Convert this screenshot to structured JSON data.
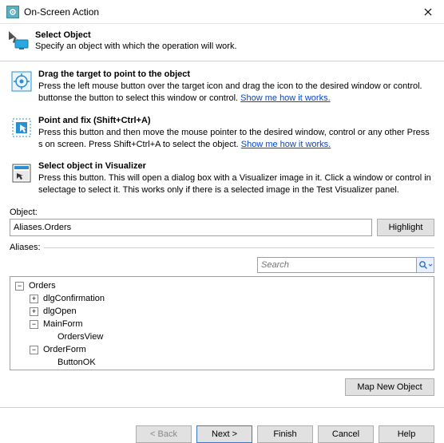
{
  "titlebar": {
    "title": "On-Screen Action"
  },
  "header": {
    "heading": "Select Object",
    "sub": "Specify an object with which the operation will work."
  },
  "methods": {
    "drag": {
      "title": "Drag the target to point to the object",
      "desc_a": "Press the left mouse button over the target icon and drag the icon to the desired window or control. ",
      "desc_b": "button",
      "desc_c": "se the button to select this window or control. ",
      "link": "Show me how it works."
    },
    "point": {
      "title": "Point and fix (Shift+Ctrl+A)",
      "desc_a": "Press this button and then move the mouse pointer to the desired window, control or any other ",
      "desc_b": "Press ",
      "desc_c": "s on screen. Press Shift+Ctrl+A to select the object. ",
      "link": "Show me how it works."
    },
    "vis": {
      "title": "Select object in Visualizer",
      "desc_a": "Press this button. This will open a dialog box with a Visualizer image in it. Click a window or control in ",
      "desc_b": "select",
      "desc_c": "age to select it. This works only if there is a selected image in the Test Visualizer panel."
    }
  },
  "object": {
    "label": "Object:",
    "value": "Aliases.Orders",
    "highlight_label": "Highlight"
  },
  "aliases": {
    "label": "Aliases:",
    "search_placeholder": "Search",
    "tree": {
      "root": "Orders",
      "items": [
        {
          "exp": "+",
          "label": "dlgConfirmation",
          "indent": 1
        },
        {
          "exp": "+",
          "label": "dlgOpen",
          "indent": 1
        },
        {
          "exp": "-",
          "label": "MainForm",
          "indent": 1
        },
        {
          "exp": "",
          "label": "OrdersView",
          "indent": 2
        },
        {
          "exp": "-",
          "label": "OrderForm",
          "indent": 1
        },
        {
          "exp": "",
          "label": "ButtonOK",
          "indent": 2
        }
      ]
    },
    "map_label": "Map New Object"
  },
  "wizard": {
    "back": "< Back",
    "next": "Next >",
    "finish": "Finish",
    "cancel": "Cancel",
    "help": "Help"
  }
}
